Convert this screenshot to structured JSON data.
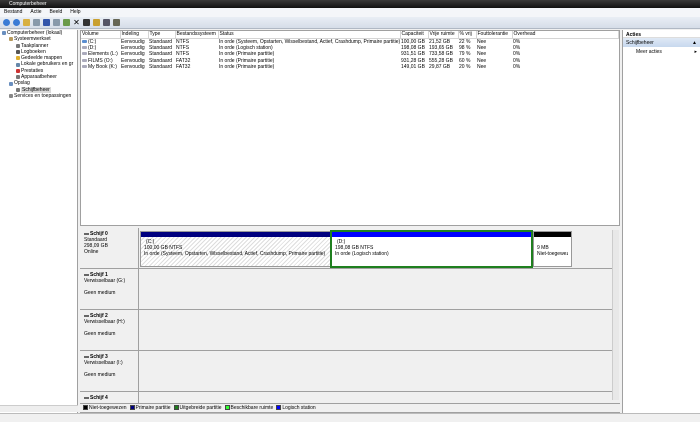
{
  "window": {
    "title": "Computerbeheer"
  },
  "menu": [
    "Bestand",
    "Actie",
    "Beeld",
    "Help"
  ],
  "tree": [
    {
      "label": "Computerbeheer (lokaal)",
      "level": 0,
      "color": "#6a8fbf"
    },
    {
      "label": "Systeemwerkset",
      "level": 1,
      "color": "#b89b5e"
    },
    {
      "label": "Taakplanner",
      "level": 2,
      "color": "#777"
    },
    {
      "label": "Logboeken",
      "level": 2,
      "color": "#555"
    },
    {
      "label": "Gedeelde mappen",
      "level": 2,
      "color": "#e0b030"
    },
    {
      "label": "Lokale gebruikers en gr",
      "level": 2,
      "color": "#6688aa"
    },
    {
      "label": "Prestaties",
      "level": 2,
      "color": "#cc3333"
    },
    {
      "label": "Apparaatbeheer",
      "level": 2,
      "color": "#777"
    },
    {
      "label": "Opslag",
      "level": 1,
      "color": "#6a8fbf"
    },
    {
      "label": "Schijfbeheer",
      "level": 2,
      "color": "#777",
      "selected": true
    },
    {
      "label": "Services en toepassingen",
      "level": 1,
      "color": "#888"
    }
  ],
  "volumes": {
    "columns": [
      "Volume",
      "Indeling",
      "Type",
      "Bestandssysteem",
      "Status",
      "Capaciteit",
      "Vrije ruimte",
      "% vrij",
      "Fouttolerantie",
      "Overhead"
    ],
    "rows": [
      [
        "(C:)",
        "Eenvoudig",
        "Standaard",
        "NTFS",
        "In orde (Systeem, Opstarten, Wisselbestand, Actief, Crashdump, Primaire partitie)",
        "100,00 GB",
        "21,52 GB",
        "22 %",
        "Nee",
        "0%"
      ],
      [
        "(D:)",
        "Eenvoudig",
        "Standaard",
        "NTFS",
        "In orde (Logisch station)",
        "198,08 GB",
        "193,65 GB",
        "98 %",
        "Nee",
        "0%"
      ],
      [
        "Elements (L:)",
        "Eenvoudig",
        "Standaard",
        "NTFS",
        "In orde (Primaire partitie)",
        "931,51 GB",
        "733,58 GB",
        "79 %",
        "Nee",
        "0%"
      ],
      [
        "FILMS (O:)",
        "Eenvoudig",
        "Standaard",
        "FAT32",
        "In orde (Primaire partitie)",
        "931,28 GB",
        "555,28 GB",
        "60 %",
        "Nee",
        "0%"
      ],
      [
        "My Book (K:)",
        "Eenvoudig",
        "Standaard",
        "FAT32",
        "In orde (Primaire partitie)",
        "149,01 GB",
        "29,87 GB",
        "20 %",
        "Nee",
        "0%"
      ]
    ]
  },
  "disks": [
    {
      "name": "Schijf 0",
      "lines": [
        "Standaard",
        "298,09 GB",
        "Online"
      ],
      "partitions": [
        {
          "name": "(C:)",
          "size": "100,00 GB NTFS",
          "status": "In orde (Systeem, Opstarten, Wisselbestand, Actief, Crashdump, Primaire partitie)",
          "color": "#00007f"
        },
        {
          "name": "(D:)",
          "size": "198,08 GB NTFS",
          "status": "In orde (Logisch station)",
          "color": "#0000ff"
        },
        {
          "name": "",
          "size": "9 MB",
          "status": "Niet-toegewez",
          "color": "#000000"
        }
      ]
    },
    {
      "name": "Schijf 1",
      "lines": [
        "Verwisselbaar (G:)",
        "",
        "Geen medium"
      ]
    },
    {
      "name": "Schijf 2",
      "lines": [
        "Verwisselbaar (H:)",
        "",
        "Geen medium"
      ]
    },
    {
      "name": "Schijf 3",
      "lines": [
        "Verwisselbaar (I:)",
        "",
        "Geen medium"
      ]
    },
    {
      "name": "Schijf 4",
      "lines": []
    }
  ],
  "legend": [
    {
      "label": "Niet-toegewezen",
      "color": "#000000"
    },
    {
      "label": "Primaire partitie",
      "color": "#00007f"
    },
    {
      "label": "Uitgebreide partitie",
      "color": "#1f7f1f"
    },
    {
      "label": "Beschikbare ruimte",
      "color": "#33ff33"
    },
    {
      "label": "Logisch station",
      "color": "#0000ff"
    }
  ],
  "actions": {
    "title": "Acties",
    "section": "Schijfbeheer",
    "item": "Meer acties"
  }
}
